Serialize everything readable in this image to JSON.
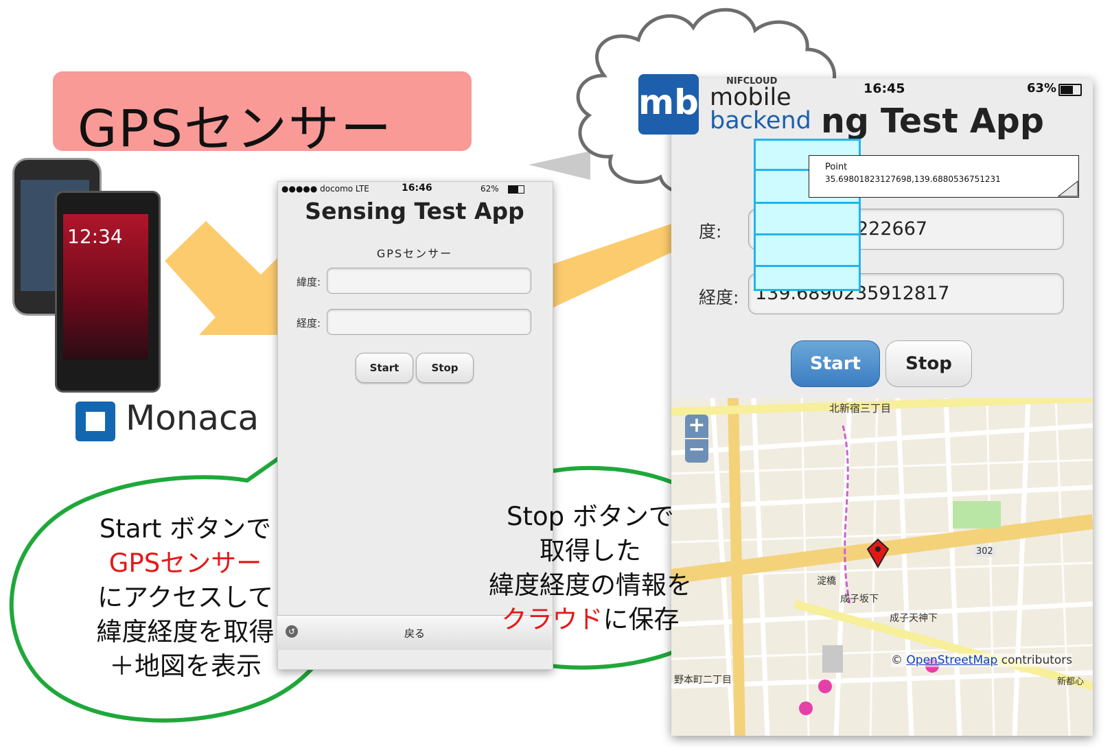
{
  "title_banner": {
    "text": "GPSセンサー"
  },
  "monaca": {
    "logo_text": "Monaca"
  },
  "left_phone": {
    "clock": "12:34"
  },
  "mid_app": {
    "carrier": "●●●●● docomo LTE",
    "time": "16:46",
    "battery": "62%",
    "title": "Sensing Test App",
    "subtitle": "GPSセンサー",
    "lat_label": "緯度:",
    "lng_label": "経度:",
    "start_label": "Start",
    "stop_label": "Stop",
    "back_label": "戻る"
  },
  "mbaas": {
    "brand_small": "NIFCLOUD",
    "logo_mark": "mb",
    "word1": "mobile",
    "word2": "backend"
  },
  "note": {
    "title": "Point",
    "value": "35.69801823127698,139.6880536751231"
  },
  "right_app": {
    "time": "16:45",
    "battery": "63%",
    "title": "ng Test App",
    "lat_label": "度:",
    "lat_value": "222667",
    "lng_label": "経度:",
    "lng_value": "139.6890235912817",
    "start_label": "Start",
    "stop_label": "Stop"
  },
  "map": {
    "zoom_in": "+",
    "zoom_out": "−",
    "attribution_prefix": "© ",
    "attribution_link": "OpenStreetMap",
    "attribution_suffix": " contributors",
    "labels": [
      "北新宿三丁目",
      "302",
      "成子坂下",
      "成子天神下",
      "淀橋",
      "野本町二丁目",
      "新都心"
    ]
  },
  "bubble_left": {
    "line1": "Start ボタンで",
    "line2": "GPSセンサー",
    "line3": "にアクセスして",
    "line4": "緯度経度を取得",
    "line5": "＋地図を表示"
  },
  "bubble_right": {
    "line1": "Stop ボタンで",
    "line2": "取得した",
    "line3": "緯度経度の情報を",
    "line4a": "クラウド",
    "line4b": "に保存"
  },
  "colors": {
    "banner": "#f99a96",
    "arrow": "#fcc865",
    "bubble_border": "#1fa83a",
    "highlight": "#e51818",
    "db_fill": "#cdfbff",
    "db_border": "#20b4f0",
    "mbaas_blue": "#1d5fad"
  }
}
